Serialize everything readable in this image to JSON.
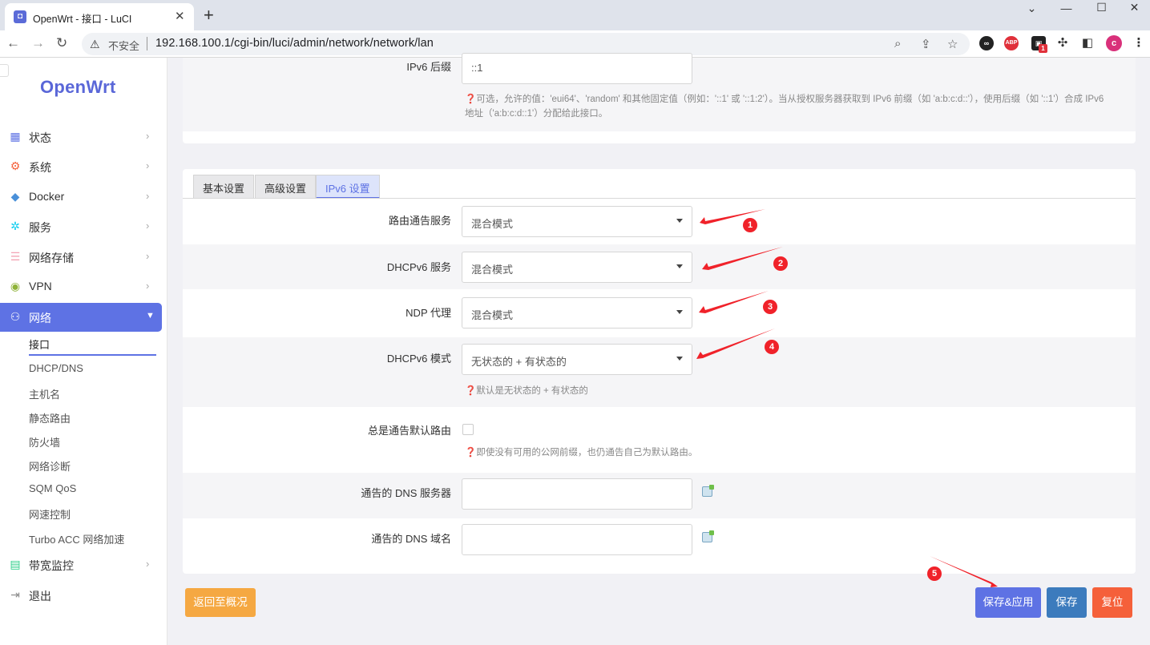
{
  "browser": {
    "tab_title": "OpenWrt - 接口 - LuCI",
    "tab_close": "✕",
    "new_tab": "+",
    "insecure_label": "不安全",
    "url": "192.168.100.1/cgi-bin/luci/admin/network/network/lan",
    "profile_initial": "c",
    "ext_badge": "1",
    "abp_label": "ABP"
  },
  "sidebar": {
    "logo": "OpenWrt",
    "menu": [
      {
        "label": "状态",
        "icon": "dashboard-icon",
        "color": "#5e72e4"
      },
      {
        "label": "系统",
        "icon": "gear-icon",
        "color": "#f5603a"
      },
      {
        "label": "Docker",
        "icon": "docker-icon",
        "color": "#4a90d9"
      },
      {
        "label": "服务",
        "icon": "services-icon",
        "color": "#11cdef"
      },
      {
        "label": "网络存储",
        "icon": "storage-icon",
        "color": "#f3a4b5"
      },
      {
        "label": "VPN",
        "icon": "vpn-icon",
        "color": "#8fb339"
      },
      {
        "label": "网络",
        "icon": "network-icon",
        "color": "#ffffff"
      },
      {
        "label": "带宽监控",
        "icon": "bandwidth-icon",
        "color": "#2dce89"
      },
      {
        "label": "退出",
        "icon": "logout-icon",
        "color": "#888888"
      }
    ],
    "submenu": [
      "接口",
      "DHCP/DNS",
      "主机名",
      "静态路由",
      "防火墙",
      "网络诊断",
      "SQM QoS",
      "网速控制",
      "Turbo ACC 网络加速"
    ]
  },
  "top_section": {
    "ipv6_suffix_label": "IPv6 后缀",
    "ipv6_suffix_value": "::1",
    "hint_line1": "❓可选，允许的值：'eui64'、'random' 和其他固定值（例如：'::1' 或 '::1:2'）。当从授权服务器获取到 IPv6 前缀（如 'a:b:c:d::'），使用后缀（如 '::1'）合成 IPv6",
    "hint_line2": "地址（'a:b:c:d::1'）分配给此接口。"
  },
  "tabs": [
    "基本设置",
    "高级设置",
    "IPv6 设置"
  ],
  "ipv6_settings": {
    "ra_service_label": "路由通告服务",
    "ra_service_value": "混合模式",
    "dhcpv6_service_label": "DHCPv6 服务",
    "dhcpv6_service_value": "混合模式",
    "ndp_proxy_label": "NDP 代理",
    "ndp_proxy_value": "混合模式",
    "dhcpv6_mode_label": "DHCPv6 模式",
    "dhcpv6_mode_value": "无状态的 + 有状态的",
    "dhcpv6_mode_hint": "❓默认是无状态的 + 有状态的",
    "default_route_label": "总是通告默认路由",
    "default_route_hint": "❓即使没有可用的公网前缀，也仍通告自己为默认路由。",
    "dns_server_label": "通告的 DNS 服务器",
    "dns_domain_label": "通告的 DNS 域名"
  },
  "buttons": {
    "back": "返回至概况",
    "save_apply": "保存&应用",
    "save": "保存",
    "reset": "复位"
  },
  "annotations": [
    "1",
    "2",
    "3",
    "4",
    "5"
  ],
  "colors": {
    "accent": "#5e72e4",
    "back_button": "#f5a842",
    "save_button": "#3c7bbd",
    "reset_button": "#f5603a",
    "annotation": "#f0222a"
  }
}
